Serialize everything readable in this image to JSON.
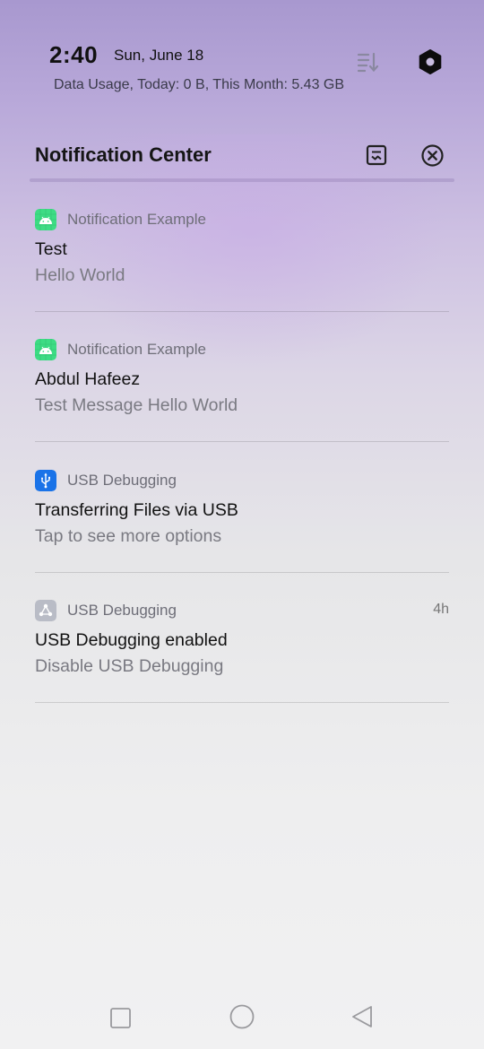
{
  "status": {
    "time": "2:40",
    "date": "Sun, June 18",
    "data_usage": "Data Usage, Today: 0 B, This Month: 5.43 GB"
  },
  "header_icons": {
    "sort": "sort-icon",
    "settings": "settings-hexagon-icon"
  },
  "notification_center": {
    "title": "Notification Center",
    "manage_icon": "manage-notifications-icon",
    "clear_icon": "clear-all-icon"
  },
  "notifications": [
    {
      "app": "Notification Example",
      "icon": "android-app-icon",
      "icon_color": "#3ddc84",
      "title": "Test",
      "body": "Hello World",
      "time": ""
    },
    {
      "app": "Notification Example",
      "icon": "android-app-icon",
      "icon_color": "#3ddc84",
      "title": "Abdul Hafeez",
      "body": "Test Message Hello World",
      "time": ""
    },
    {
      "app": "USB Debugging",
      "icon": "usb-icon",
      "icon_color": "#1a73e8",
      "title": "Transferring Files via USB",
      "body": "Tap to see more options",
      "time": ""
    },
    {
      "app": "USB Debugging",
      "icon": "share-nodes-icon",
      "icon_color": "#b9bcc6",
      "title": "USB Debugging enabled",
      "body": "Disable USB Debugging",
      "time": "4h"
    }
  ],
  "nav": {
    "recents": "square-icon",
    "home": "circle-icon",
    "back": "triangle-back-icon"
  }
}
